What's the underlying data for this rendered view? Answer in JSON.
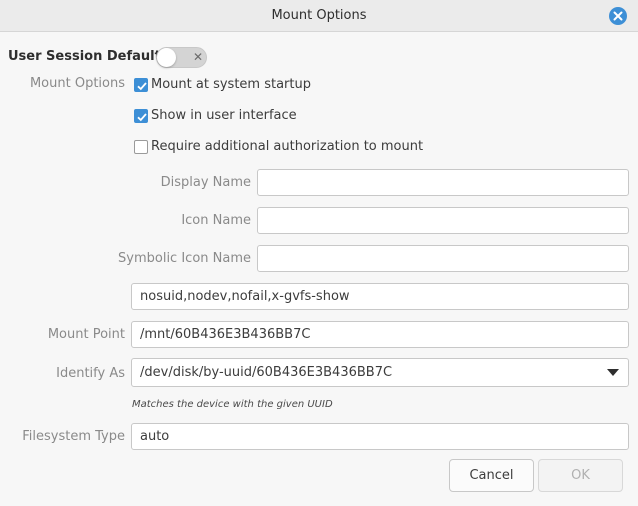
{
  "window": {
    "title": "Mount Options"
  },
  "section": {
    "title": "User Session Defaults"
  },
  "labels": {
    "mount_options": "Mount Options",
    "display_name": "Display Name",
    "icon_name": "Icon Name",
    "symbolic_icon_name": "Symbolic Icon Name",
    "mount_point": "Mount Point",
    "identify_as": "Identify As",
    "filesystem_type": "Filesystem Type"
  },
  "checkboxes": [
    {
      "label": "Mount at system startup",
      "checked": true
    },
    {
      "label": "Show in user interface",
      "checked": true
    },
    {
      "label": "Require additional authorization to mount",
      "checked": false
    }
  ],
  "fields": {
    "display_name": "",
    "icon_name": "",
    "symbolic_icon_name": "",
    "options": "nosuid,nodev,nofail,x-gvfs-show",
    "mount_point": "/mnt/60B436E3B436BB7C",
    "identify_as": "/dev/disk/by-uuid/60B436E3B436BB7C",
    "filesystem_type": "auto"
  },
  "hint": "Matches the device with the given UUID",
  "buttons": {
    "cancel": "Cancel",
    "ok": "OK"
  },
  "colors": {
    "accent": "#3d8fd6"
  }
}
